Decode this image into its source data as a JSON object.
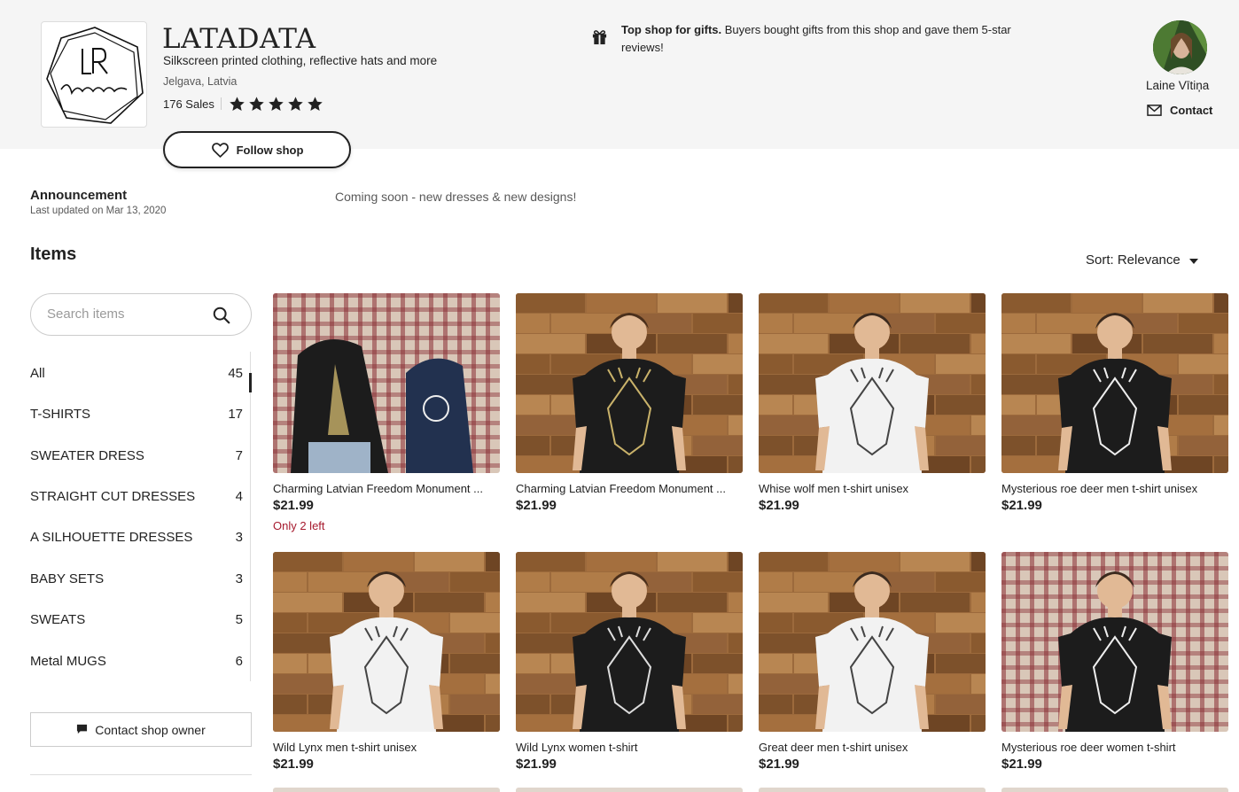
{
  "shop": {
    "name": "LATADATA",
    "tagline": "Silkscreen printed clothing, reflective hats and more",
    "location": "Jelgava, Latvia",
    "sales": "176 Sales",
    "rating_stars": 5,
    "follow_label": "Follow shop"
  },
  "gift_notice": {
    "bold": "Top shop for gifts.",
    "text": " Buyers bought gifts from this shop and gave them 5-star reviews!"
  },
  "owner": {
    "name": "Laine Vītiņa",
    "contact_label": "Contact"
  },
  "announcement": {
    "title": "Announcement",
    "updated": "Last updated on Mar 13, 2020",
    "text": "Coming soon - new dresses & new designs!"
  },
  "items": {
    "heading": "Items",
    "sort_label": "Sort: Relevance"
  },
  "search": {
    "placeholder": "Search items"
  },
  "sidebar": {
    "categories": [
      {
        "label": "All",
        "count": "45"
      },
      {
        "label": "T-SHIRTS",
        "count": "17"
      },
      {
        "label": "SWEATER DRESS",
        "count": "7"
      },
      {
        "label": "STRAIGHT CUT DRESSES",
        "count": "4"
      },
      {
        "label": "A SILHOUETTE DRESSES",
        "count": "3"
      },
      {
        "label": "BABY SETS",
        "count": "3"
      },
      {
        "label": "SWEATS",
        "count": "5"
      },
      {
        "label": "Metal MUGS",
        "count": "6"
      }
    ],
    "contact_owner_label": "Contact shop owner"
  },
  "listings": [
    {
      "title": "Charming Latvian Freedom Monument ...",
      "price": "$21.99",
      "stock": "Only 2 left"
    },
    {
      "title": "Charming Latvian Freedom Monument ...",
      "price": "$21.99"
    },
    {
      "title": "Whise wolf men t-shirt unisex",
      "price": "$21.99"
    },
    {
      "title": "Mysterious roe deer men t-shirt unisex",
      "price": "$21.99"
    },
    {
      "title": "Wild Lynx men t-shirt unisex",
      "price": "$21.99"
    },
    {
      "title": "Wild Lynx women t-shirt",
      "price": "$21.99"
    },
    {
      "title": "Great deer men t-shirt unisex",
      "price": "$21.99"
    },
    {
      "title": "Mysterious roe deer women t-shirt",
      "price": "$21.99"
    }
  ],
  "colors": {
    "header_bg": "#f5f5f5",
    "stock_red": "#a61a2e",
    "wood": "#9c6a3c",
    "shirt_black": "#1c1c1c",
    "shirt_white": "#f2f2f2",
    "shirt_navy": "#22314f"
  }
}
